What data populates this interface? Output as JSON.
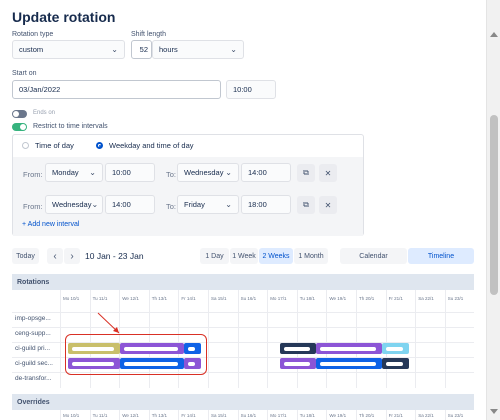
{
  "dialog": {
    "title": "Update rotation"
  },
  "rotation_type": {
    "label": "Rotation type",
    "value": "custom"
  },
  "shift_length": {
    "label": "Shift length",
    "number": "52",
    "unit": "hours"
  },
  "start_on": {
    "label": "Start on",
    "date": "03/Jan/2022",
    "time": "10:00"
  },
  "ends_on": {
    "label": "Ends on",
    "enabled": false
  },
  "restrict": {
    "label": "Restrict to time intervals",
    "enabled": true
  },
  "interval_mode": {
    "option1": "Time of day",
    "option2": "Weekday and time of day",
    "selected": "option2"
  },
  "intervals": [
    {
      "from_label": "From:",
      "from_day": "Monday",
      "from_time": "10:00",
      "to_label": "To:",
      "to_day": "Wednesday",
      "to_time": "14:00"
    },
    {
      "from_label": "From:",
      "from_day": "Wednesday",
      "from_time": "14:00",
      "to_label": "To:",
      "to_day": "Friday",
      "to_time": "18:00"
    }
  ],
  "add_interval": "+ Add new interval",
  "calendar": {
    "today": "Today",
    "prev": "‹",
    "next": "›",
    "range": "10 Jan - 23 Jan",
    "views": [
      "1 Day",
      "1 Week",
      "2 Weeks",
      "1 Month"
    ],
    "active_view": "2 Weeks",
    "modes": [
      "Calendar",
      "Timeline"
    ],
    "active_mode": "Timeline"
  },
  "rotations_section": {
    "label": "Rotations"
  },
  "days": [
    "Mo 10/1",
    "Tu 11/1",
    "We 12/1",
    "Th 13/1",
    "Fr 14/1",
    "Sa 15/1",
    "Su 16/1",
    "Mo 17/1",
    "Tu 18/1",
    "We 19/1",
    "Th 20/1",
    "Fr 21/1",
    "Sa 22/1",
    "Su 23/1"
  ],
  "rows": [
    "imp-opsge...",
    "ceng-supp...",
    "ci-guild pri...",
    "ci-guild sec...",
    "de-transfor..."
  ],
  "overrides_section": {
    "label": "Overrides"
  },
  "colors": {
    "accent": "#0052cc",
    "toggle_on": "#36b37e",
    "toggle_off": "#6b778c",
    "bar_olive": "#c9bf6b",
    "bar_purple": "#8c55d6",
    "bar_blue": "#0f62e6",
    "bar_navy": "#253858",
    "bar_sky": "#7fd4f0",
    "annotation": "#d93025"
  }
}
